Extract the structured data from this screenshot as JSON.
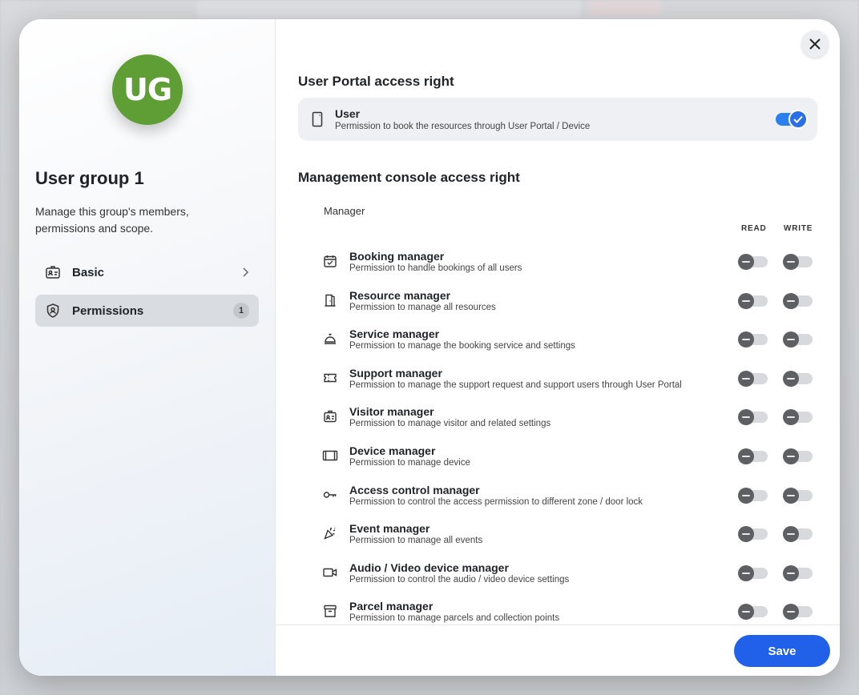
{
  "group": {
    "initials": "UG",
    "avatar_color": "#5f9e35",
    "title": "User group 1",
    "description": "Manage this group's members, permissions and scope."
  },
  "nav": {
    "basic": {
      "label": "Basic",
      "icon": "id-badge-icon"
    },
    "permissions": {
      "label": "Permissions",
      "icon": "shield-icon",
      "badge": "1"
    }
  },
  "portal": {
    "section_title": "User Portal access right",
    "item": {
      "title": "User",
      "desc": "Permission to book the resources through User Portal / Device",
      "enabled": true
    }
  },
  "console": {
    "section_title": "Management console access right",
    "group_label": "Manager",
    "col_read": "READ",
    "col_write": "WRITE",
    "items": [
      {
        "icon": "calendar-check-icon",
        "title": "Booking manager",
        "desc": "Permission to handle bookings of all users",
        "read": false,
        "write": false
      },
      {
        "icon": "door-icon",
        "title": "Resource manager",
        "desc": "Permission to manage all resources",
        "read": false,
        "write": false
      },
      {
        "icon": "service-bell-icon",
        "title": "Service manager",
        "desc": "Permission to manage the booking service and settings",
        "read": false,
        "write": false
      },
      {
        "icon": "ticket-icon",
        "title": "Support manager",
        "desc": "Permission to manage the support request and support users through User Portal",
        "read": false,
        "write": false
      },
      {
        "icon": "visitor-badge-icon",
        "title": "Visitor manager",
        "desc": "Permission to manage visitor and related settings",
        "read": false,
        "write": false
      },
      {
        "icon": "device-icon",
        "title": "Device manager",
        "desc": "Permission to manage device",
        "read": false,
        "write": false
      },
      {
        "icon": "key-icon",
        "title": "Access control manager",
        "desc": "Permission to control the access permission to different zone / door lock",
        "read": false,
        "write": false
      },
      {
        "icon": "party-popper-icon",
        "title": "Event manager",
        "desc": "Permission to manage all events",
        "read": false,
        "write": false
      },
      {
        "icon": "video-camera-icon",
        "title": "Audio / Video device manager",
        "desc": "Permission to control the audio / video device settings",
        "read": false,
        "write": false
      },
      {
        "icon": "archive-box-icon",
        "title": "Parcel manager",
        "desc": "Permission to manage parcels and collection points",
        "read": false,
        "write": false
      }
    ]
  },
  "footer": {
    "save_label": "Save"
  },
  "colors": {
    "accent": "#2160e8",
    "toggle_on": "#2b80f0",
    "toggle_off_knob": "#5d5f63"
  }
}
